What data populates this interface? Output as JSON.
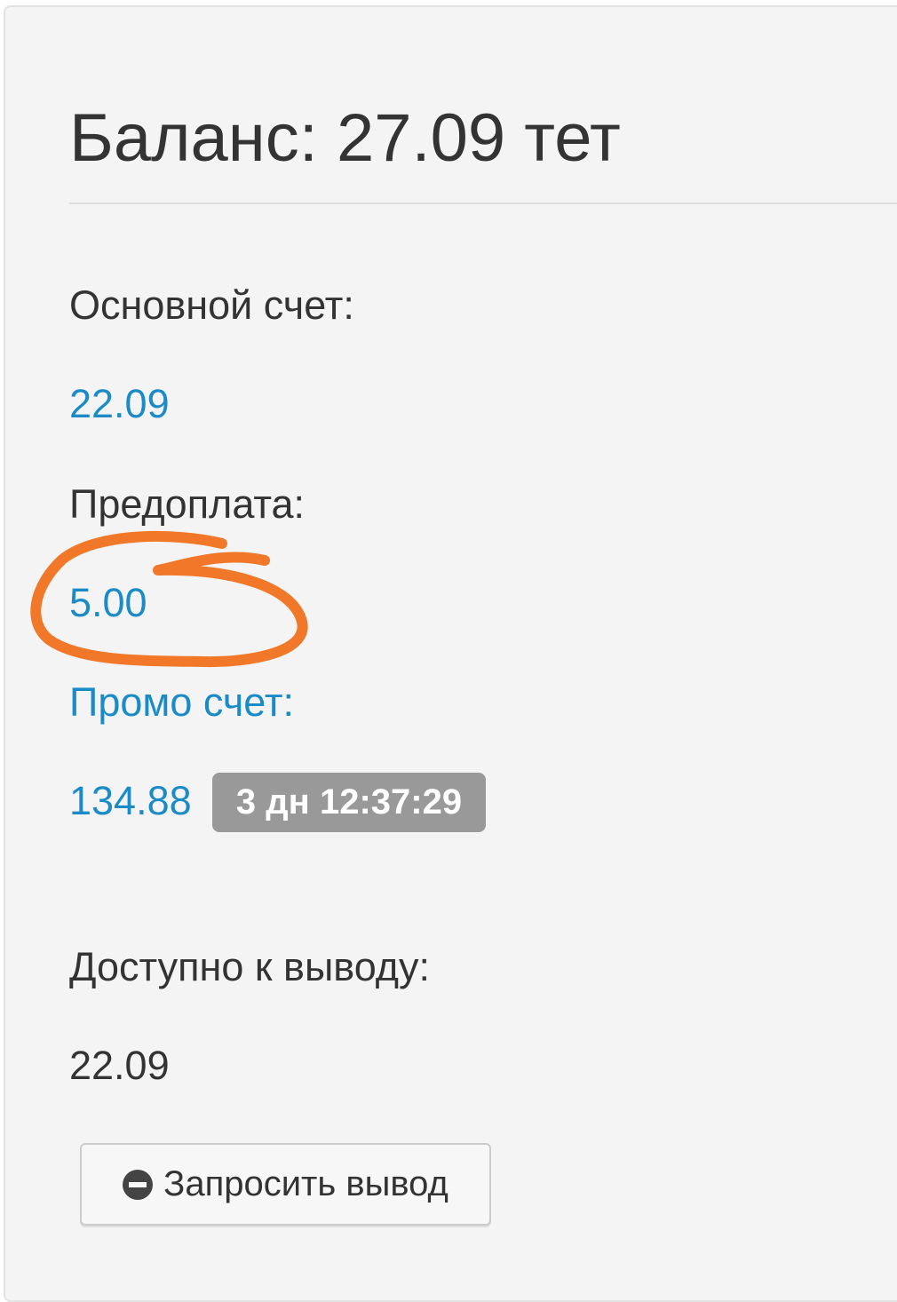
{
  "balance": {
    "title": "Баланс: 27.09 тет"
  },
  "accounts": {
    "main": {
      "label": "Основной счет:",
      "value": "22.09"
    },
    "prepayment": {
      "label": "Предоплата:",
      "value": "5.00"
    },
    "promo": {
      "label": "Промо счет:",
      "value": "134.88",
      "timer": "3 дн 12:37:29"
    },
    "available": {
      "label": "Доступно к выводу:",
      "value": "22.09"
    }
  },
  "actions": {
    "request_withdrawal_label": "Запросить вывод",
    "request_withdrawal_icon": "minus-circle-icon"
  },
  "colors": {
    "link_blue": "#1a8bc6",
    "annotation_orange": "#f07828",
    "timer_badge": "#999999"
  }
}
